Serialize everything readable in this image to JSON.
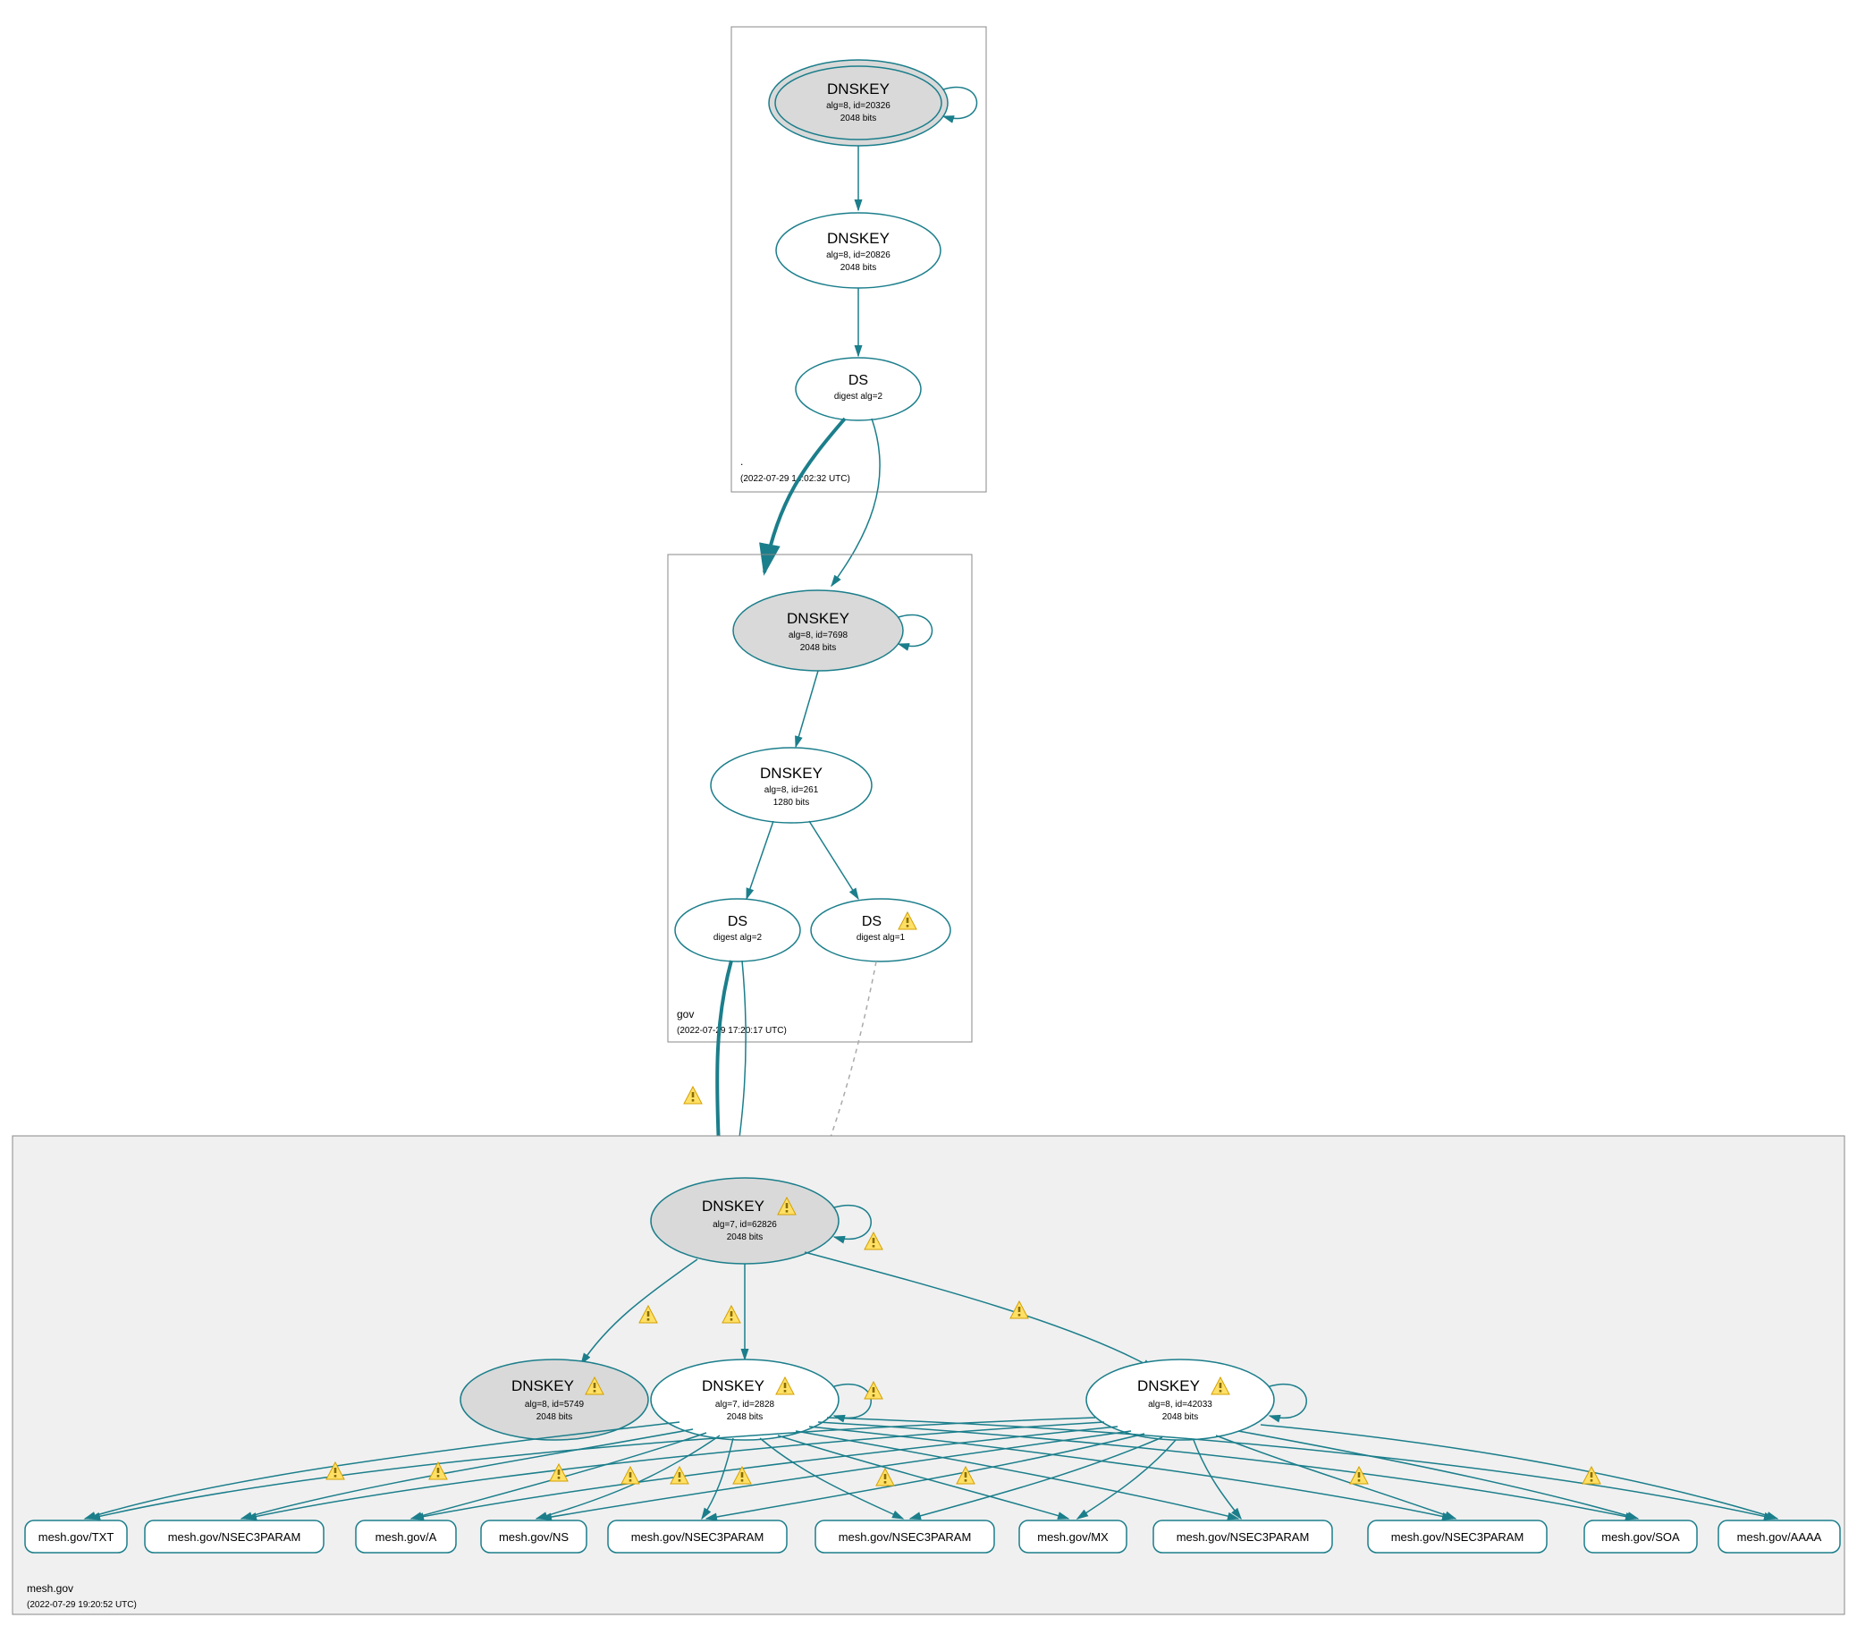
{
  "colors": {
    "teal": "#1B7E8B",
    "ksk_fill": "#d9d9d9",
    "box": "#888888"
  },
  "zones": {
    "root": {
      "label": ".",
      "timestamp": "(2022-07-29 14:02:32 UTC)",
      "nodes": {
        "ksk": {
          "title": "DNSKEY",
          "line2": "alg=8, id=20326",
          "line3": "2048 bits"
        },
        "zsk": {
          "title": "DNSKEY",
          "line2": "alg=8, id=20826",
          "line3": "2048 bits"
        },
        "ds": {
          "title": "DS",
          "line2": "digest alg=2"
        }
      }
    },
    "gov": {
      "label": "gov",
      "timestamp": "(2022-07-29 17:20:17 UTC)",
      "nodes": {
        "ksk": {
          "title": "DNSKEY",
          "line2": "alg=8, id=7698",
          "line3": "2048 bits"
        },
        "zsk": {
          "title": "DNSKEY",
          "line2": "alg=8, id=261",
          "line3": "1280 bits"
        },
        "ds1": {
          "title": "DS",
          "line2": "digest alg=2"
        },
        "ds2": {
          "title": "DS",
          "line2": "digest alg=1"
        }
      }
    },
    "mesh": {
      "label": "mesh.gov",
      "timestamp": "(2022-07-29 19:20:52 UTC)",
      "nodes": {
        "ksk": {
          "title": "DNSKEY",
          "line2": "alg=7, id=62826",
          "line3": "2048 bits"
        },
        "zsk_a": {
          "title": "DNSKEY",
          "line2": "alg=8, id=5749",
          "line3": "2048 bits"
        },
        "zsk_b": {
          "title": "DNSKEY",
          "line2": "alg=7, id=2828",
          "line3": "2048 bits"
        },
        "zsk_c": {
          "title": "DNSKEY",
          "line2": "alg=8, id=42033",
          "line3": "2048 bits"
        }
      },
      "rrsets": [
        "mesh.gov/TXT",
        "mesh.gov/NSEC3PARAM",
        "mesh.gov/A",
        "mesh.gov/NS",
        "mesh.gov/NSEC3PARAM",
        "mesh.gov/NSEC3PARAM",
        "mesh.gov/MX",
        "mesh.gov/NSEC3PARAM",
        "mesh.gov/NSEC3PARAM",
        "mesh.gov/SOA",
        "mesh.gov/AAAA"
      ]
    }
  }
}
